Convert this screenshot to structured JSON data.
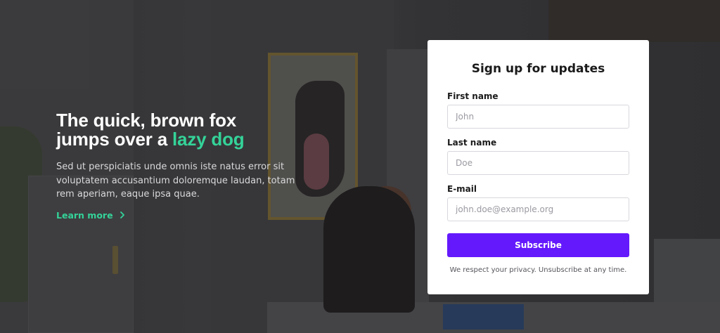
{
  "hero": {
    "title_line1": "The quick, brown fox",
    "title_line2_prefix": "jumps over a ",
    "title_accent": "lazy dog",
    "description": "Sed ut perspiciatis unde omnis iste natus error sit voluptatem accusantium doloremque laudan, totam rem aperiam, eaque ipsa quae.",
    "learn_more_label": "Learn more",
    "learn_more_icon": "chevron-right-icon"
  },
  "form": {
    "title": "Sign up for updates",
    "first_name": {
      "label": "First name",
      "placeholder": "John",
      "value": ""
    },
    "last_name": {
      "label": "Last name",
      "placeholder": "Doe",
      "value": ""
    },
    "email": {
      "label": "E-mail",
      "placeholder": "john.doe@example.org",
      "value": ""
    },
    "subscribe_label": "Subscribe",
    "privacy_note": "We respect your privacy. Unsubscribe at any time."
  },
  "colors": {
    "accent": "#34d399",
    "button": "#6419fc",
    "card_background": "#ffffff"
  }
}
